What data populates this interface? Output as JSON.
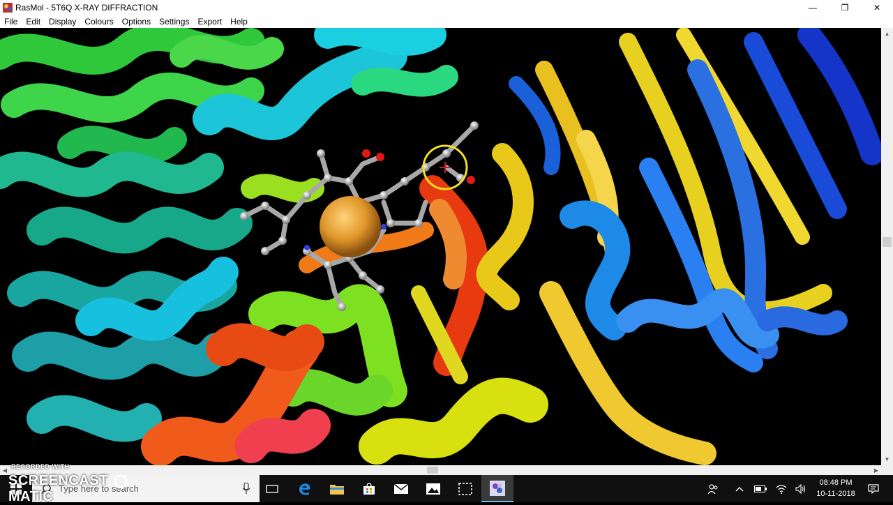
{
  "window": {
    "title": "RasMol - 5T6Q X-RAY DIFFRACTION"
  },
  "controls": {
    "minimize": "—",
    "restore": "❐",
    "close": "✕"
  },
  "menu": [
    "File",
    "Edit",
    "Display",
    "Colours",
    "Options",
    "Settings",
    "Export",
    "Help"
  ],
  "taskbar": {
    "search_placeholder": "Type here to search",
    "time": "08:48 PM",
    "date": "10-11-2018"
  },
  "watermark": {
    "line1": "RECORDED WITH",
    "line2": "SCREENCAST",
    "line3": "MATIC"
  },
  "colors": {
    "titlebar": "#ffffff",
    "viewport": "#000000",
    "taskbar": "#101010",
    "accent": "#76b9ed"
  },
  "icons": [
    "rasmol-app-icon",
    "windows-start-icon",
    "search-icon",
    "mic-icon",
    "task-view-icon",
    "edge-icon",
    "file-explorer-icon",
    "store-icon",
    "mail-icon",
    "photos-icon",
    "snipping-tool-icon",
    "rasmol-taskbar-icon",
    "people-icon",
    "chevron-up-icon",
    "battery-icon",
    "wifi-icon",
    "volume-icon",
    "notification-icon"
  ]
}
